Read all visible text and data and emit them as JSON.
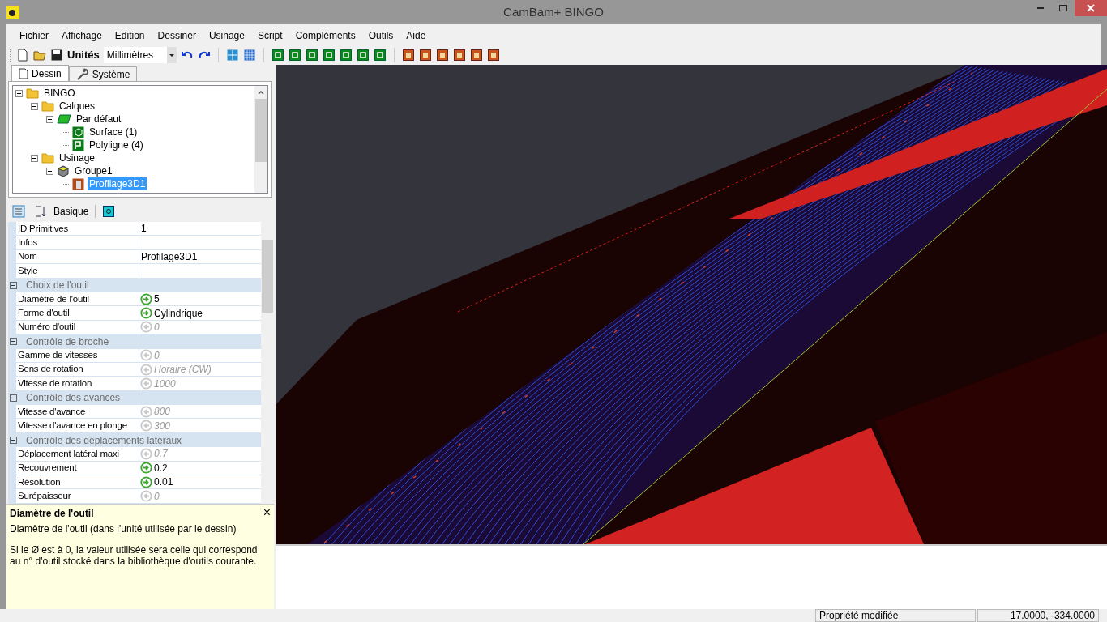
{
  "window": {
    "title": "CamBam+  BINGO"
  },
  "menu": [
    "Fichier",
    "Affichage",
    "Edition",
    "Dessiner",
    "Usinage",
    "Script",
    "Compléments",
    "Outils",
    "Aide"
  ],
  "toolbar": {
    "units_label": "Unités",
    "units_value": "Millimètres"
  },
  "tabs": [
    {
      "label": "Dessin",
      "selected": true
    },
    {
      "label": "Système",
      "selected": false
    }
  ],
  "tree": [
    {
      "label": "BINGO",
      "kind": "folder",
      "expanded": true,
      "selected": false,
      "children": [
        {
          "label": "Calques",
          "kind": "folder",
          "expanded": true,
          "selected": false,
          "children": [
            {
              "label": "Par défaut",
              "kind": "layer",
              "expanded": true,
              "selected": false,
              "children": [
                {
                  "label": "Surface (1)",
                  "kind": "surface",
                  "selected": false
                },
                {
                  "label": "Polyligne (4)",
                  "kind": "polyline",
                  "selected": false
                }
              ]
            }
          ]
        },
        {
          "label": "Usinage",
          "kind": "folder",
          "expanded": true,
          "selected": false,
          "children": [
            {
              "label": "Groupe1",
              "kind": "group",
              "expanded": true,
              "selected": false,
              "children": [
                {
                  "label": "Profilage3D1",
                  "kind": "operation",
                  "selected": true
                }
              ]
            }
          ]
        }
      ]
    }
  ],
  "properties_toolbar": {
    "mode": "Basique"
  },
  "properties": [
    {
      "kind": "plain",
      "name": "ID Primitives",
      "value": "1"
    },
    {
      "kind": "plain",
      "name": "Infos"
    },
    {
      "kind": "plain",
      "name": "Nom",
      "value": "Profilage3D1"
    },
    {
      "kind": "plain",
      "name": "Style"
    },
    {
      "kind": "group",
      "name": "Choix de l'outil",
      "expanded": true
    },
    {
      "kind": "custom",
      "name": "Diamètre de l'outil",
      "value": "5"
    },
    {
      "kind": "custom",
      "name": "Forme d'outil",
      "value": "Cylindrique"
    },
    {
      "kind": "default",
      "name": "Numéro d'outil",
      "value": "0"
    },
    {
      "kind": "group",
      "name": "Contrôle de broche",
      "expanded": true
    },
    {
      "kind": "default",
      "name": "Gamme de vitesses",
      "value": "0"
    },
    {
      "kind": "default",
      "name": "Sens de rotation",
      "value": "Horaire (CW)"
    },
    {
      "kind": "default",
      "name": "Vitesse de rotation",
      "value": "1000"
    },
    {
      "kind": "group",
      "name": "Contrôle des avances",
      "expanded": true
    },
    {
      "kind": "default",
      "name": "Vitesse d'avance",
      "value": "800"
    },
    {
      "kind": "default",
      "name": "Vitesse d'avance en plonge",
      "value": "300"
    },
    {
      "kind": "group",
      "name": "Contrôle des déplacements latéraux",
      "expanded": true
    },
    {
      "kind": "default",
      "name": "Déplacement latéral maxi",
      "value": "0.7"
    },
    {
      "kind": "custom",
      "name": "Recouvrement",
      "value": "0.2"
    },
    {
      "kind": "custom",
      "name": "Résolution",
      "value": "0.01"
    },
    {
      "kind": "default",
      "name": "Surépaisseur",
      "value": "0"
    }
  ],
  "help": {
    "title": "Diamètre de l'outil",
    "close": "×",
    "paragraphs": [
      "Diamètre de l'outil (dans l'unité utilisée par le dessin)",
      "Si le Ø est à 0, la valeur utilisée sera celle qui correspond au n° d'outil stocké dans la bibliothèque d'outils courante."
    ]
  },
  "status_bar": [
    "Propriété modifiée",
    "17.0000, -334.0000"
  ]
}
